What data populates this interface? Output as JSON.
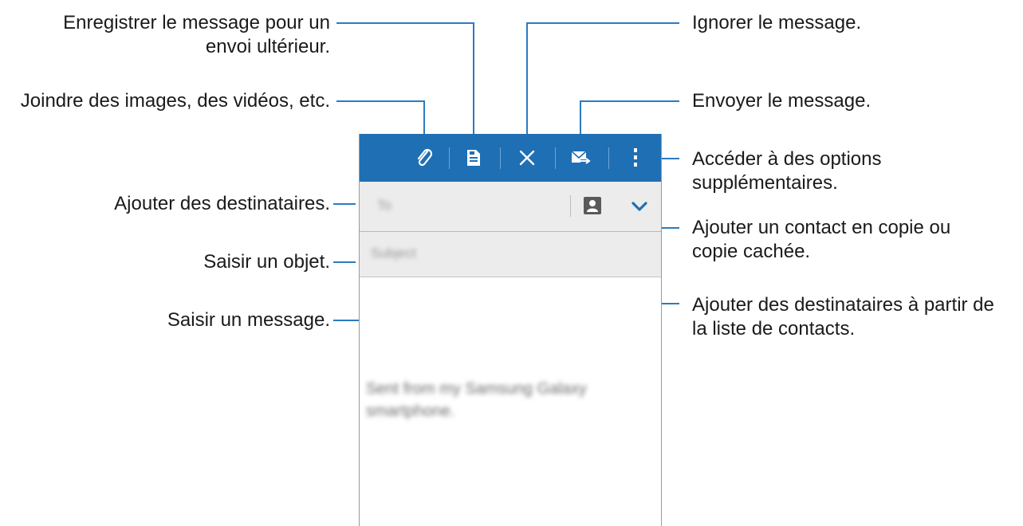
{
  "callouts": {
    "save_draft": "Enregistrer le message pour un\nenvoi ultérieur.",
    "discard": "Ignorer le message.",
    "attach": "Joindre des images, des vidéos, etc.",
    "send": "Envoyer le message.",
    "more_options": "Accéder à des options\nsupplémentaires.",
    "add_recipients": "Ajouter des destinataires.",
    "cc_bcc": "Ajouter un contact en copie ou\ncopie cachée.",
    "subject": "Saisir un objet.",
    "contacts_list": "Ajouter des destinataires à partir de\nla liste de contacts.",
    "message": "Saisir un message."
  },
  "compose": {
    "to_placeholder": "To",
    "subject_placeholder": "Subject",
    "signature": "Sent from my Samsung Galaxy smartphone."
  },
  "toolbar": {
    "icons": [
      "paperclip-icon",
      "save-icon",
      "close-icon",
      "send-email-icon",
      "more-vert-icon"
    ]
  },
  "colors": {
    "toolbar": "#1f6fb5",
    "callout_line": "#2b7bbf",
    "field_bg": "#ececec"
  }
}
